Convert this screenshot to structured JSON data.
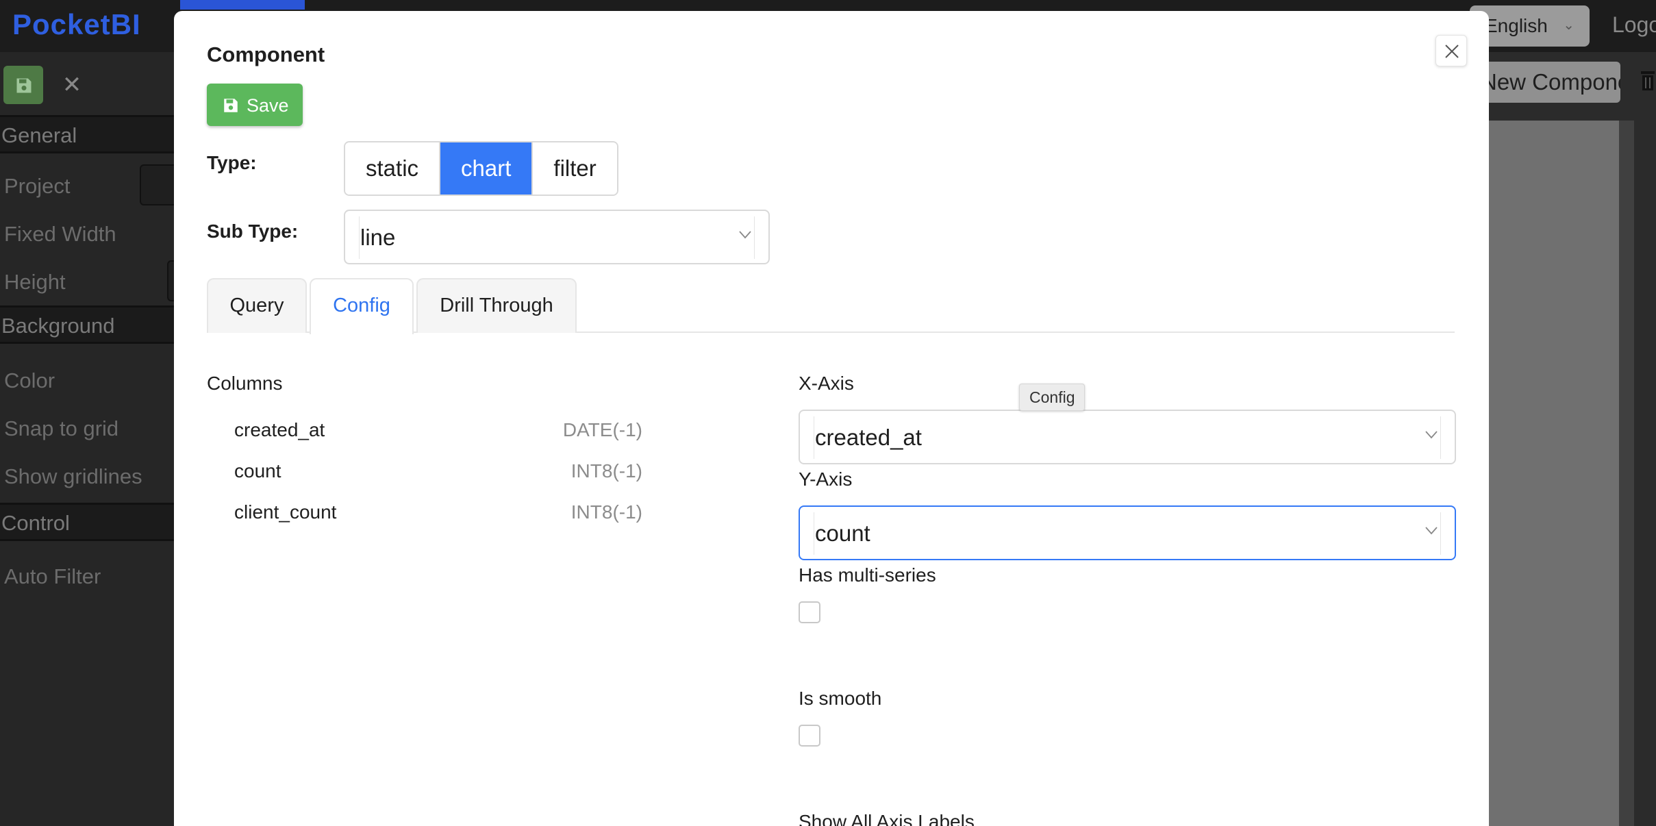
{
  "app": {
    "logo": "PocketBI",
    "language": "English",
    "logout": "Logout",
    "new_component_label": "New Component"
  },
  "sidebar": {
    "sections": [
      {
        "label": "General"
      },
      {
        "label": "Background"
      },
      {
        "label": "Control"
      }
    ],
    "items": [
      {
        "label": "Project"
      },
      {
        "label": "Fixed Width"
      },
      {
        "label": "Height"
      },
      {
        "label": "Color"
      },
      {
        "label": "Snap to grid"
      },
      {
        "label": "Show gridlines"
      },
      {
        "label": "Auto Filter"
      }
    ]
  },
  "modal": {
    "title": "Component",
    "save_label": "Save",
    "type_label": "Type:",
    "type_options": [
      "static",
      "chart",
      "filter"
    ],
    "type_selected": "chart",
    "subtype_label": "Sub Type:",
    "subtype_value": "line",
    "tabs": [
      "Query",
      "Config",
      "Drill Through"
    ],
    "active_tab": "Config",
    "tooltip": "Config",
    "columns_title": "Columns",
    "columns": [
      {
        "name": "created_at",
        "type": "DATE(-1)"
      },
      {
        "name": "count",
        "type": "INT8(-1)"
      },
      {
        "name": "client_count",
        "type": "INT8(-1)"
      }
    ],
    "config": {
      "x_axis_label": "X-Axis",
      "x_axis_value": "created_at",
      "y_axis_label": "Y-Axis",
      "y_axis_value": "count",
      "multi_series_label": "Has multi-series",
      "multi_series_checked": false,
      "smooth_label": "Is smooth",
      "smooth_checked": false,
      "show_all_axis_labels_label": "Show All Axis Labels"
    }
  },
  "colors": {
    "primary": "#3579f6",
    "save_green": "#5cb85c",
    "logo_blue": "#2f5fe0"
  },
  "icons": {
    "save": "floppy-disk-icon",
    "close": "x-icon",
    "chevron": "chevron-down-icon",
    "trash": "trash-icon"
  }
}
